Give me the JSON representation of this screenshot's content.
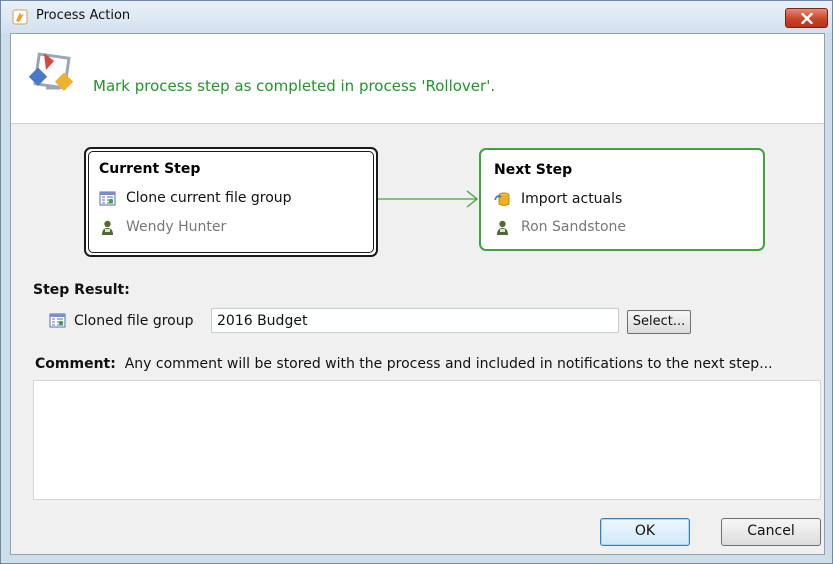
{
  "window": {
    "title": "Process Action",
    "icons": {
      "app": "app-icon",
      "close": "close-icon"
    }
  },
  "header": {
    "message": "Mark process step as completed in process 'Rollover'.",
    "icon": "process-action-icon",
    "message_color": "#22952a"
  },
  "current_step": {
    "title": "Current Step",
    "task": "Clone current file group",
    "task_icon": "file-group-icon",
    "assignee": "Wendy Hunter",
    "assignee_icon": "user-icon"
  },
  "next_step": {
    "title": "Next Step",
    "task": "Import actuals",
    "task_icon": "database-import-icon",
    "assignee": "Ron Sandstone",
    "assignee_icon": "user-icon",
    "border_color": "#3fa43f"
  },
  "step_result": {
    "label": "Step Result:",
    "description": "Cloned file group",
    "value": "2016 Budget",
    "select_label": "Select..."
  },
  "comment": {
    "label": "Comment:",
    "hint": "Any comment will be stored with the process and included in notifications to the next step...",
    "value": ""
  },
  "buttons": {
    "ok": "OK",
    "cancel": "Cancel"
  }
}
